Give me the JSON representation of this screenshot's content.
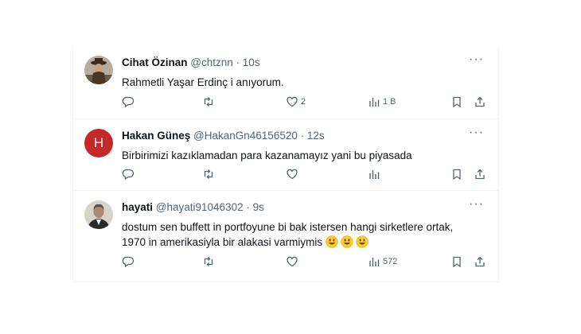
{
  "tweets": [
    {
      "name": "Cihat Özinan",
      "handle": "@chtznn",
      "time": "10s",
      "text": "Rahmetli Yaşar Erdinç i anıyorum.",
      "likes": "2",
      "views": "1 B",
      "more": "···"
    },
    {
      "name": "Hakan Güneş",
      "handle": "@HakanGn46156520",
      "time": "12s",
      "avatar_letter": "H",
      "text": "Birbirimizi kazıklamadan para kazanamayız yani bu piyasada",
      "more": "···"
    },
    {
      "name": "hayati",
      "handle": "@hayati91046302",
      "time": "9s",
      "text_line1": "dostum sen buffett in portfoyune bi bak istersen hangi sirketlere ortak,",
      "text_line2": "1970 in amerikasiyla bir alakasi varmiymis",
      "views": "572",
      "more": "···"
    }
  ],
  "separator": "·",
  "colors": {
    "avatar_letter_bg": "#c62828",
    "icon_gray": "#536471",
    "border": "#eff3f4"
  }
}
